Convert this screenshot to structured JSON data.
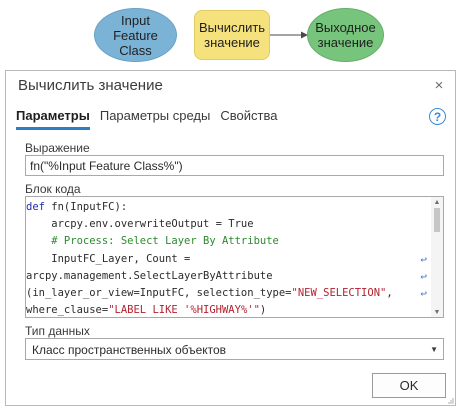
{
  "diagram": {
    "input_node": "Input\nFeature\nClass",
    "tool_node": "Вычислить\nзначение",
    "output_node": "Выходное\nзначение"
  },
  "dialog": {
    "title": "Вычислить значение",
    "close_icon": "×",
    "tabs": [
      "Параметры",
      "Параметры среды",
      "Свойства"
    ],
    "active_tab": "Параметры",
    "help_icon": "?",
    "expression_label": "Выражение",
    "expression_value": "fn(\"%Input Feature Class%\")",
    "code_label": "Блок кода",
    "code_lines": [
      "def fn(InputFC):",
      "    arcpy.env.overwriteOutput = True",
      "    # Process: Select Layer By Attribute",
      "    InputFC_Layer, Count =",
      "arcpy.management.SelectLayerByAttribute",
      "(in_layer_or_view=InputFC, selection_type=\"NEW_SELECTION\",",
      "where_clause=\"LABEL LIKE '%HIGHWAY%'\")"
    ],
    "datatype_label": "Тип данных",
    "datatype_value": "Класс пространственных объектов",
    "ok_label": "OK"
  },
  "colors": {
    "input_node": "#7bb3d6",
    "tool_node": "#f5e27c",
    "output_node": "#77c47c",
    "accent": "#2f7ec4"
  }
}
